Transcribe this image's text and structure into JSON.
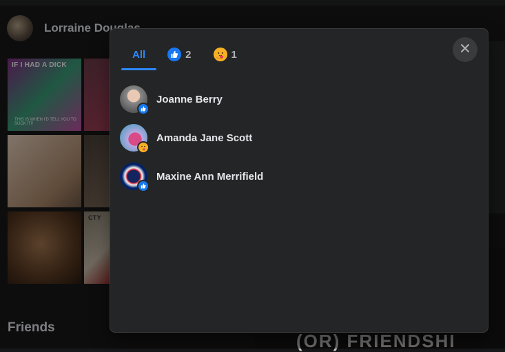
{
  "background": {
    "profile_name": "Lorraine Douglas",
    "meme_top_text": "IF I HAD A DICK",
    "meme_bottom_text": "THIS IS WHEN I'D TELL YOU TO SUCK IT!!",
    "tile_label": "CTY",
    "friends_heading": "Friends",
    "right_banner_text": "(OR) FRIENDSHI"
  },
  "modal": {
    "tabs": [
      {
        "label": "All",
        "icon": "",
        "active": true
      },
      {
        "label": "2",
        "icon": "like-icon",
        "active": false
      },
      {
        "label": "1",
        "icon": "care-icon",
        "active": false
      }
    ],
    "close_icon": "close-icon",
    "reactions": [
      {
        "name": "Joanne Berry",
        "reaction": "like-icon"
      },
      {
        "name": "Amanda Jane Scott",
        "reaction": "care-icon"
      },
      {
        "name": "Maxine Ann Merrifield",
        "reaction": "like-icon"
      }
    ]
  },
  "colors": {
    "accent": "#2d88ff",
    "modal_bg": "#242526",
    "page_bg": "#18191a",
    "like": "#1877f2",
    "care": "#f7b125"
  }
}
